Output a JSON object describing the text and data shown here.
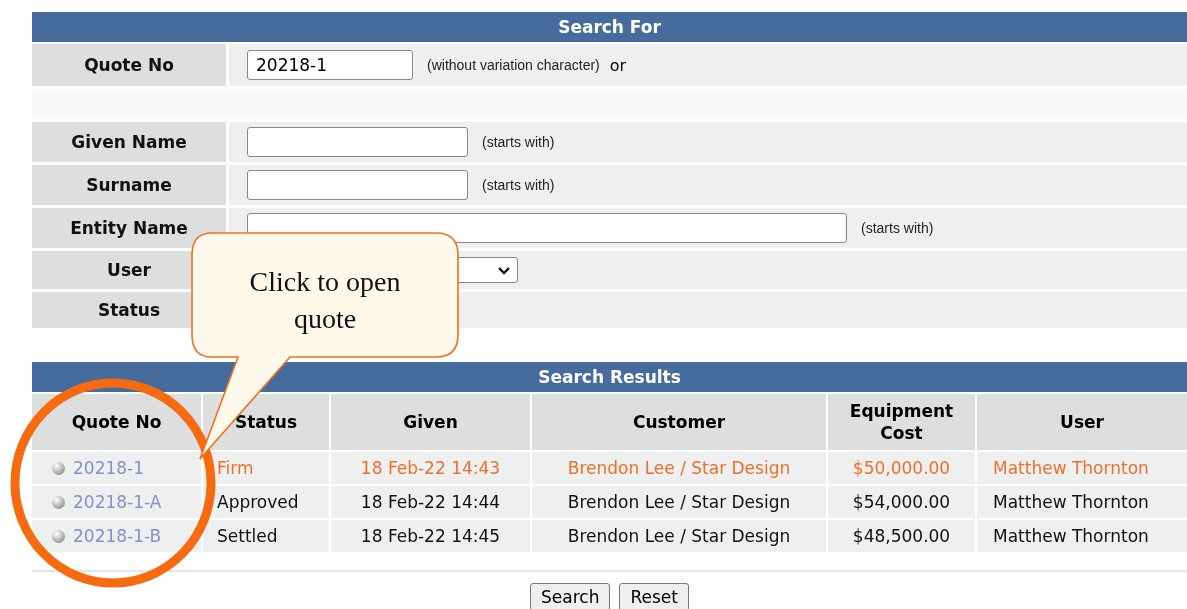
{
  "search_for": {
    "title": "Search For",
    "fields": [
      {
        "kind": "text",
        "label": "Quote No",
        "value": "20218-1",
        "hint": "(without variation character)",
        "suffix": "or"
      },
      {
        "kind": "text",
        "label": "Given Name",
        "hint": "(starts with)"
      },
      {
        "kind": "text",
        "label": "Surname",
        "hint": "(starts with)"
      },
      {
        "kind": "wide",
        "label": "Entity Name",
        "hint": "(starts with)"
      },
      {
        "kind": "select",
        "label": "User"
      },
      {
        "kind": "blank",
        "label": "Status"
      }
    ]
  },
  "search_results": {
    "title": "Search Results",
    "columns": [
      "Quote No",
      "Status",
      "Given",
      "Customer",
      "Equipment Cost",
      "User"
    ],
    "rows": [
      {
        "selected": true,
        "quote_no": "20218-1",
        "status": "Firm",
        "given": "18 Feb-22 14:43",
        "customer": "Brendon Lee / Star Design",
        "equipment_cost": "$50,000.00",
        "user": "Matthew Thornton"
      },
      {
        "selected": false,
        "quote_no": "20218-1-A",
        "status": "Approved",
        "given": "18 Feb-22 14:44",
        "customer": "Brendon Lee / Star Design",
        "equipment_cost": "$54,000.00",
        "user": "Matthew Thornton"
      },
      {
        "selected": false,
        "quote_no": "20218-1-B",
        "status": "Settled",
        "given": "18 Feb-22 14:45",
        "customer": "Brendon Lee / Star Design",
        "equipment_cost": "$48,500.00",
        "user": "Matthew Thornton"
      }
    ]
  },
  "buttons": [
    "Search",
    "Reset"
  ],
  "callout": {
    "text": "Click to open quote"
  }
}
